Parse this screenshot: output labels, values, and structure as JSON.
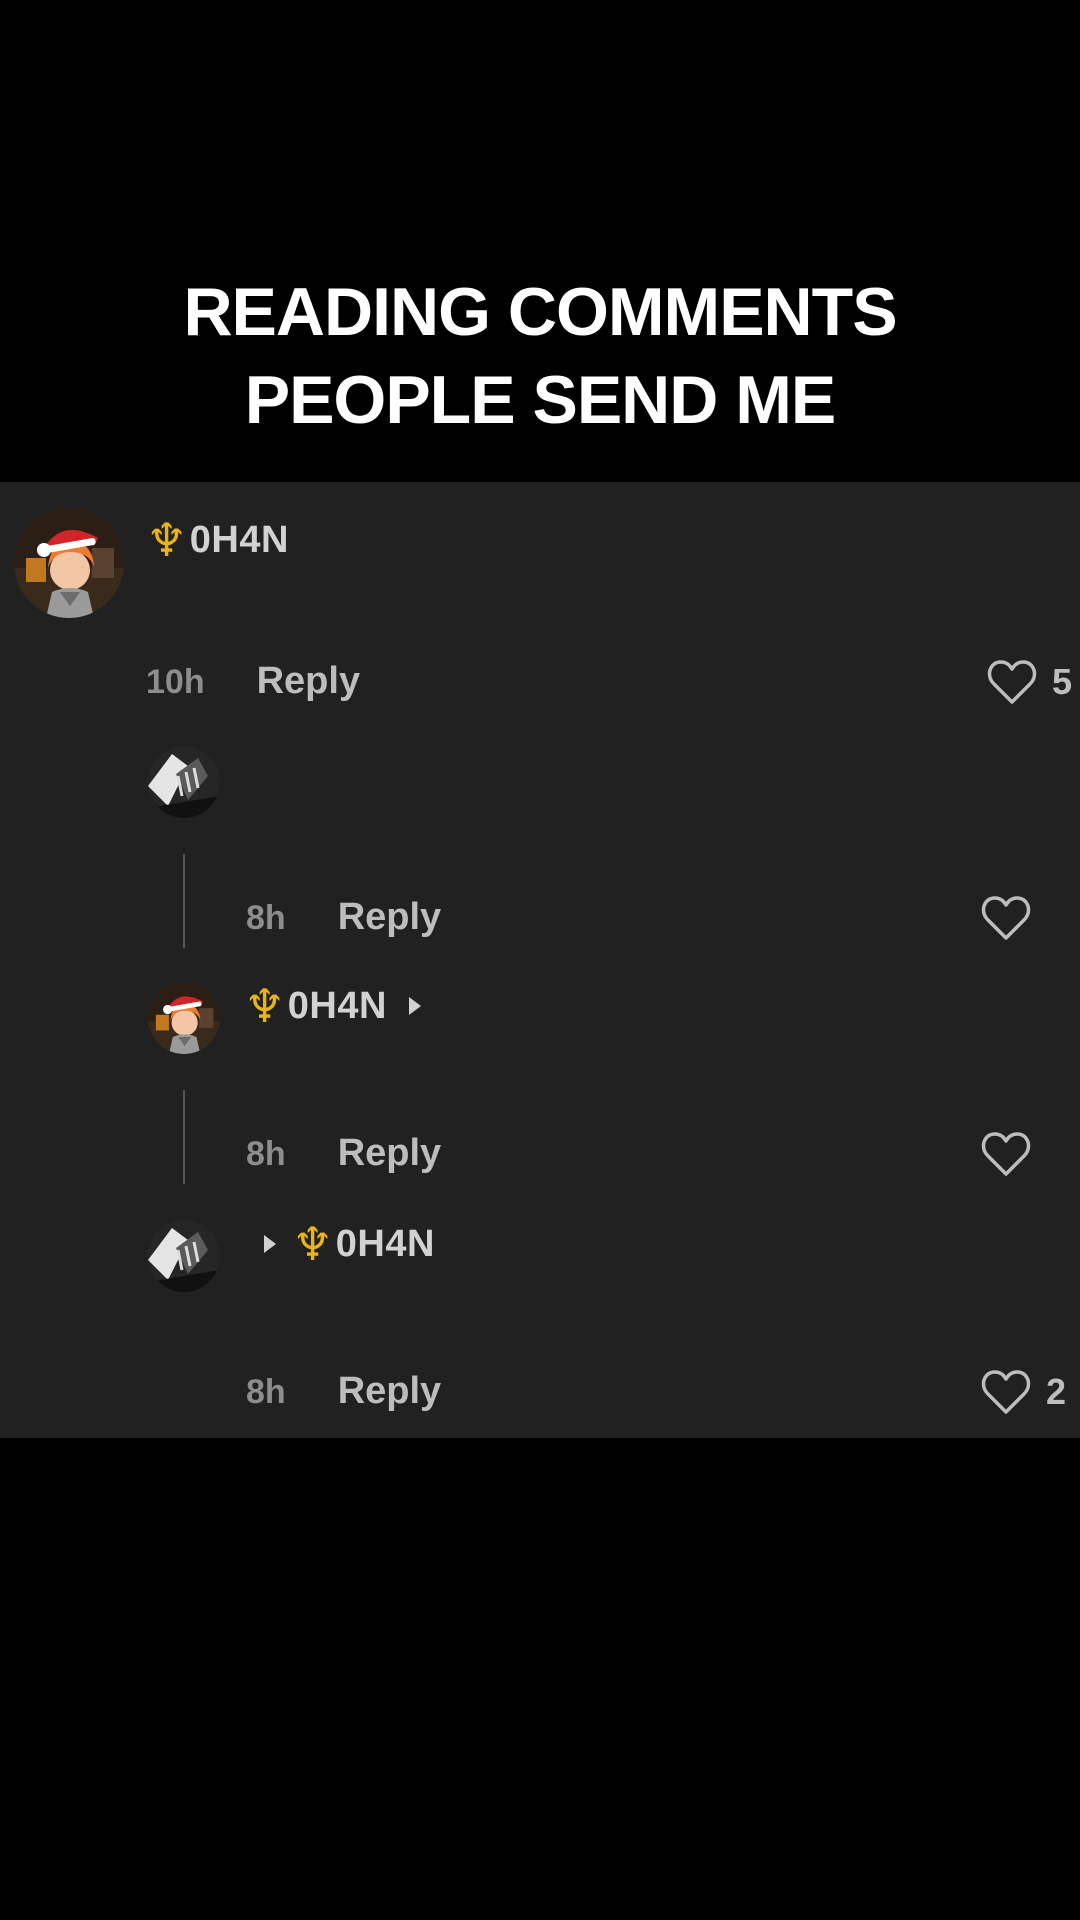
{
  "caption": {
    "line1": "READING COMMENTS",
    "line2": "PEOPLE SEND ME"
  },
  "comments": [
    {
      "username": "0H4N",
      "trident": "♆",
      "time": "10h",
      "reply_label": "Reply",
      "like_count": "5"
    },
    {
      "username": "",
      "time": "8h",
      "reply_label": "Reply",
      "like_count": ""
    },
    {
      "username": "0H4N",
      "trident": "♆",
      "time": "8h",
      "reply_label": "Reply",
      "like_count": ""
    },
    {
      "username": "0H4N",
      "trident": "♆",
      "time": "8h",
      "reply_label": "Reply",
      "like_count": "2"
    }
  ],
  "icons": {
    "like": "heart-outline-icon",
    "reply_to": "triangle-right-icon",
    "user_emblem": "trident-icon"
  },
  "colors": {
    "background": "#000000",
    "panel": "#212121",
    "caption_text": "#ffffff",
    "username_text": "#d2d2d2",
    "trident": "#e9b31a",
    "time_text": "#8d8d8d",
    "reply_text": "#bdbdbd"
  }
}
